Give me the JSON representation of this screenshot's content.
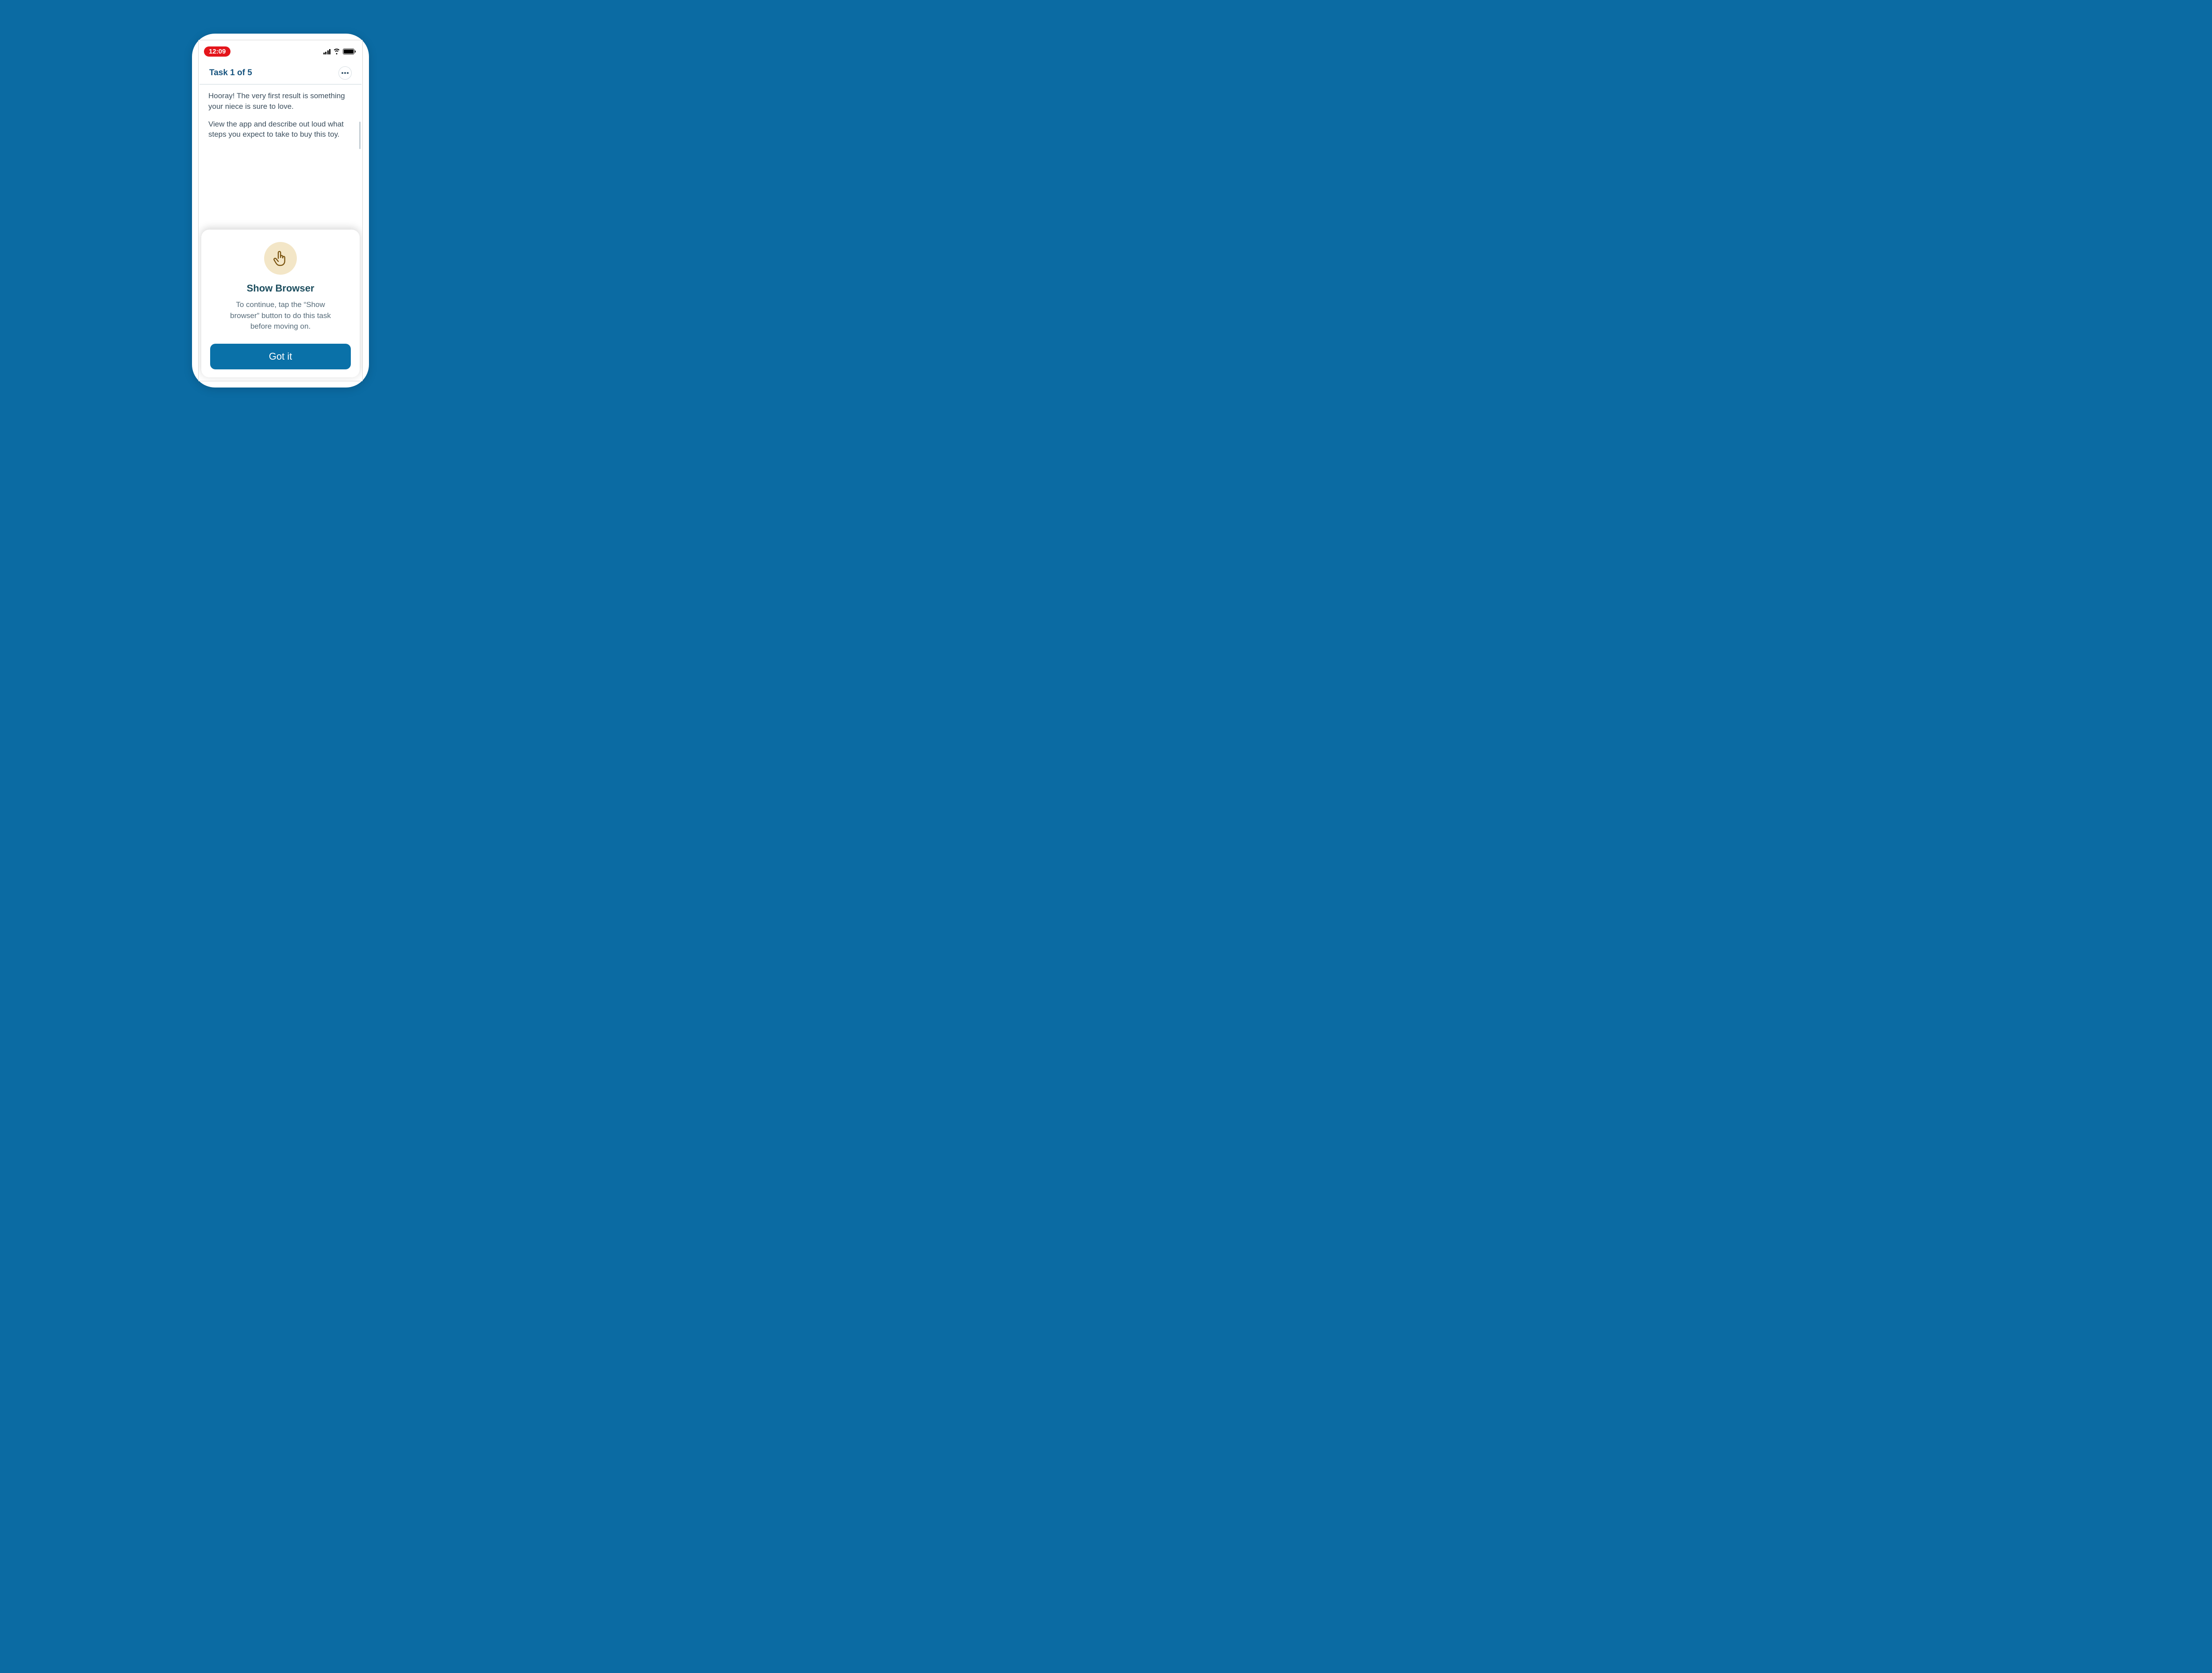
{
  "status_bar": {
    "time": "12:09"
  },
  "task": {
    "title": "Task 1 of 5",
    "paragraph1": "Hooray! The very first result is something your niece is sure to love.",
    "paragraph2": "View the app and describe out loud what steps you expect to take to buy this toy."
  },
  "modal": {
    "title": "Show Browser",
    "body": "To continue, tap the “Show browser” button to do this task before moving on.",
    "button": "Got it"
  }
}
